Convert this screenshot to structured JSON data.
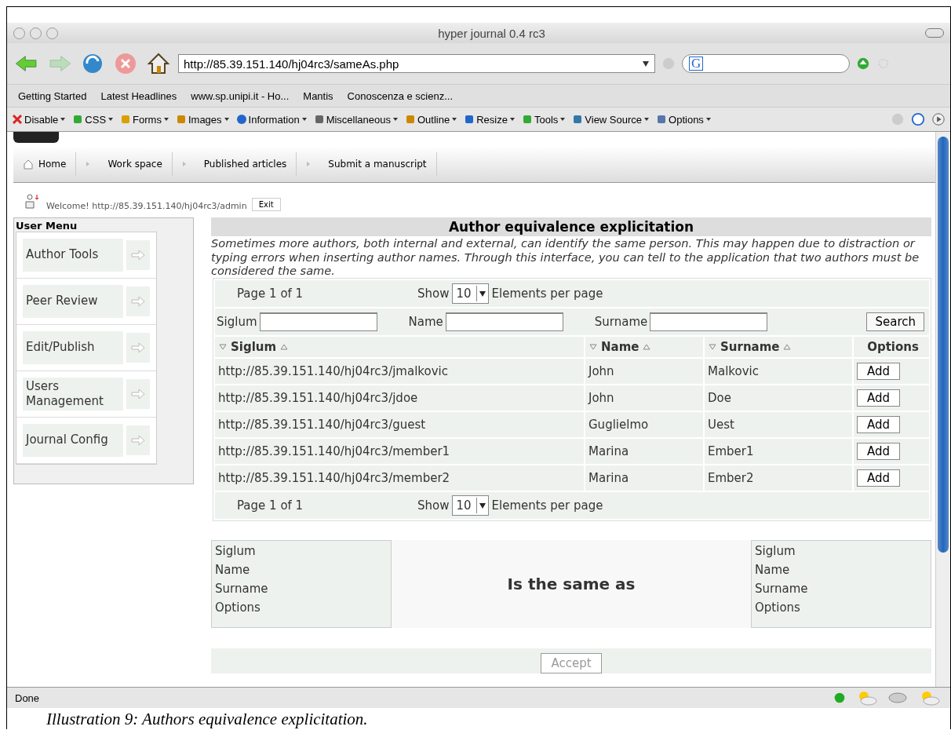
{
  "window": {
    "title": "hyper journal 0.4 rc3"
  },
  "address_bar": {
    "url": "http://85.39.151.140/hj04rc3/sameAs.php",
    "search_logo": "G"
  },
  "bookmarks": [
    "Getting Started",
    "Latest Headlines",
    "www.sp.unipi.it - Ho...",
    "Mantis",
    "Conoscenza e scienz..."
  ],
  "dev_toolbar": [
    {
      "label": "Disable",
      "kind": "cross"
    },
    {
      "label": "CSS",
      "kind": "puzzle"
    },
    {
      "label": "Forms",
      "kind": "lock"
    },
    {
      "label": "Images",
      "kind": "pen"
    },
    {
      "label": "Information",
      "kind": "info"
    },
    {
      "label": "Miscellaneous",
      "kind": "list"
    },
    {
      "label": "Outline",
      "kind": "pen"
    },
    {
      "label": "Resize",
      "kind": "window"
    },
    {
      "label": "Tools",
      "kind": "box"
    },
    {
      "label": "View Source",
      "kind": "page"
    },
    {
      "label": "Options",
      "kind": "grid"
    }
  ],
  "nav": [
    {
      "label": "Home",
      "kind": "home"
    },
    {
      "label": "Work space",
      "kind": "arrow"
    },
    {
      "label": "Published articles",
      "kind": "arrow"
    },
    {
      "label": "Submit a manuscript",
      "kind": "arrow"
    }
  ],
  "welcome": {
    "text": "Welcome! http://85.39.151.140/hj04rc3/admin",
    "button": "Exit"
  },
  "user_menu": {
    "title": "User Menu",
    "items": [
      "Author Tools",
      "Peer Review",
      "Edit/Publish",
      "Users Management",
      "Journal Config"
    ]
  },
  "main": {
    "title": "Author equivalence explicitation",
    "description": "Sometimes more authors, both internal and external, can identify the same person. This may happen due to distraction or typing errors when inserting author names. Through this interface, you can tell to the application that two authors must be considered the same.",
    "pager": {
      "page": "Page 1 of 1",
      "show": "Show",
      "per_page": "10",
      "suffix": "Elements per page"
    },
    "filters": [
      {
        "label": "Siglum"
      },
      {
        "label": "Name"
      },
      {
        "label": "Surname"
      }
    ],
    "search_button": "Search",
    "columns": [
      {
        "label": "Siglum",
        "sortable": true
      },
      {
        "label": "Name",
        "sortable": true
      },
      {
        "label": "Surname",
        "sortable": true
      },
      {
        "label": "Options",
        "sortable": false
      }
    ],
    "rows": [
      {
        "siglum": "http://85.39.151.140/hj04rc3/jmalkovic",
        "name": "John",
        "surname": "Malkovic",
        "action": "Add"
      },
      {
        "siglum": "http://85.39.151.140/hj04rc3/jdoe",
        "name": "John",
        "surname": "Doe",
        "action": "Add"
      },
      {
        "siglum": "http://85.39.151.140/hj04rc3/guest",
        "name": "Guglielmo",
        "surname": "Uest",
        "action": "Add"
      },
      {
        "siglum": "http://85.39.151.140/hj04rc3/member1",
        "name": "Marina",
        "surname": "Ember1",
        "action": "Add"
      },
      {
        "siglum": "http://85.39.151.140/hj04rc3/member2",
        "name": "Marina",
        "surname": "Ember2",
        "action": "Add"
      }
    ],
    "pager_bottom": {
      "page": "Page 1 of 1",
      "show": "Show",
      "per_page": "10",
      "suffix": "Elements per page"
    },
    "left_author": [
      "Siglum",
      "Name",
      "Surname",
      "Options"
    ],
    "same_as": "Is the same as",
    "right_author": [
      "Siglum",
      "Name",
      "Surname",
      "Options"
    ],
    "accept": {
      "label": "Accept",
      "disabled": true
    }
  },
  "status_bar": {
    "text": "Done"
  },
  "caption": "Illustration 9: Authors equivalence explicitation."
}
